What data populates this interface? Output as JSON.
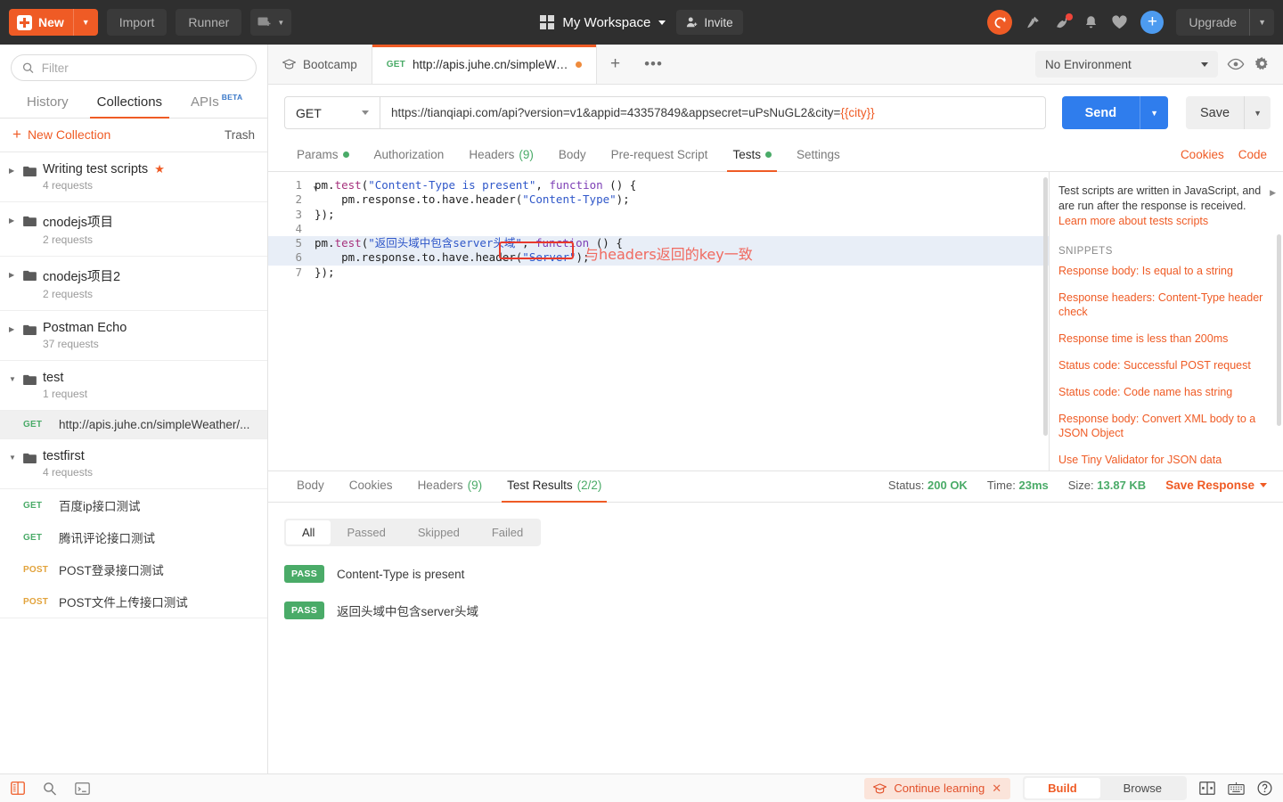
{
  "topbar": {
    "new_label": "New",
    "import_label": "Import",
    "runner_label": "Runner",
    "workspace_label": "My Workspace",
    "invite_label": "Invite",
    "upgrade_label": "Upgrade",
    "accent": "#ef5b25"
  },
  "sidebar": {
    "filter_placeholder": "Filter",
    "tabs": [
      {
        "label": "History",
        "active": false
      },
      {
        "label": "Collections",
        "active": true
      },
      {
        "label": "APIs",
        "sup": "BETA",
        "active": false
      }
    ],
    "new_collection_label": "New Collection",
    "trash_label": "Trash",
    "collections": [
      {
        "name": "Writing test scripts",
        "sub": "4 requests",
        "starred": true,
        "expanded": false
      },
      {
        "name": "cnodejs项目",
        "sub": "2 requests",
        "starred": false,
        "expanded": false
      },
      {
        "name": "cnodejs项目2",
        "sub": "2 requests",
        "starred": false,
        "expanded": false
      },
      {
        "name": "Postman Echo",
        "sub": "37 requests",
        "starred": false,
        "expanded": false
      },
      {
        "name": "test",
        "sub": "1 request",
        "starred": false,
        "expanded": true
      },
      {
        "name": "testfirst",
        "sub": "4 requests",
        "starred": false,
        "expanded": true
      }
    ],
    "test_requests": [
      {
        "method": "GET",
        "name": "http://apis.juhe.cn/simpleWeather/...",
        "selected": true
      }
    ],
    "testfirst_requests": [
      {
        "method": "GET",
        "name": "百度ip接口测试",
        "selected": false
      },
      {
        "method": "GET",
        "name": "腾讯评论接口测试",
        "selected": false
      },
      {
        "method": "POST",
        "name": "POST登录接口测试",
        "selected": false
      },
      {
        "method": "POST",
        "name": "POST文件上传接口测试",
        "selected": false
      }
    ]
  },
  "request_tabs": [
    {
      "label": "Bootcamp",
      "active": false,
      "icon": "graduation-cap"
    },
    {
      "method": "GET",
      "label": "http://apis.juhe.cn/simpleWeat...",
      "active": true,
      "unsaved": true
    }
  ],
  "environment": {
    "selected": "No Environment"
  },
  "request": {
    "method": "GET",
    "url_text": "https://tianqiapi.com/api?version=v1&appid=43357849&appsecret=uPsNuGL2&city=",
    "url_variable": "{{city}}",
    "send_label": "Send",
    "save_label": "Save",
    "tabs": [
      {
        "label": "Params",
        "dot": true,
        "active": false
      },
      {
        "label": "Authorization",
        "dot": false,
        "active": false
      },
      {
        "label": "Headers",
        "count": "(9)",
        "active": false
      },
      {
        "label": "Body",
        "dot": false,
        "active": false
      },
      {
        "label": "Pre-request Script",
        "dot": false,
        "active": false
      },
      {
        "label": "Tests",
        "dot": true,
        "active": true
      },
      {
        "label": "Settings",
        "dot": false,
        "active": false
      }
    ],
    "cookies_label": "Cookies",
    "code_label": "Code"
  },
  "editor": {
    "lines": [
      {
        "n": "1",
        "fold": true,
        "highlight": false,
        "tokens": [
          {
            "t": "pm.",
            "c": "pm"
          },
          {
            "t": "test",
            "c": "fn"
          },
          {
            "t": "(",
            "c": "pl"
          },
          {
            "t": "\"Content-Type is present\"",
            "c": "str"
          },
          {
            "t": ", ",
            "c": "pl"
          },
          {
            "t": "function",
            "c": "kw"
          },
          {
            "t": " () {",
            "c": "pl"
          }
        ]
      },
      {
        "n": "2",
        "fold": false,
        "highlight": false,
        "tokens": [
          {
            "t": "    pm.response.to.have.header(",
            "c": "pm"
          },
          {
            "t": "\"Content-Type\"",
            "c": "str"
          },
          {
            "t": ");",
            "c": "pl"
          }
        ]
      },
      {
        "n": "3",
        "fold": false,
        "highlight": false,
        "tokens": [
          {
            "t": "});",
            "c": "pl"
          }
        ]
      },
      {
        "n": "4",
        "fold": false,
        "highlight": false,
        "tokens": [
          {
            "t": "",
            "c": "pl"
          }
        ]
      },
      {
        "n": "5",
        "fold": true,
        "highlight": true,
        "tokens": [
          {
            "t": "pm.",
            "c": "pm"
          },
          {
            "t": "test",
            "c": "fn"
          },
          {
            "t": "(",
            "c": "pl"
          },
          {
            "t": "\"返回头域中包含server头域\"",
            "c": "str"
          },
          {
            "t": ", ",
            "c": "pl"
          },
          {
            "t": "function",
            "c": "kw"
          },
          {
            "t": " () {",
            "c": "pl"
          }
        ]
      },
      {
        "n": "6",
        "fold": false,
        "highlight": true,
        "tokens": [
          {
            "t": "    pm.response.to.have.header(",
            "c": "pm"
          },
          {
            "t": "\"Server\"",
            "c": "str"
          },
          {
            "t": ");",
            "c": "pl"
          }
        ]
      },
      {
        "n": "7",
        "fold": false,
        "highlight": false,
        "tokens": [
          {
            "t": "});",
            "c": "pl"
          }
        ]
      }
    ],
    "annotation_text": "与headers返回的key一致",
    "annotation_color": "#e8392c"
  },
  "snippets": {
    "description": "Test scripts are written in JavaScript, and are run after the response is received.",
    "learn_more": "Learn more about tests scripts",
    "title": "SNIPPETS",
    "items": [
      "Response body: Is equal to a string",
      "Response headers: Content-Type header check",
      "Response time is less than 200ms",
      "Status code: Successful POST request",
      "Status code: Code name has string",
      "Response body: Convert XML body to a JSON Object",
      "Use Tiny Validator for JSON data"
    ]
  },
  "response": {
    "tabs": [
      {
        "label": "Body",
        "active": false
      },
      {
        "label": "Cookies",
        "active": false
      },
      {
        "label": "Headers",
        "count": "(9)",
        "active": false
      },
      {
        "label": "Test Results",
        "count": "(2/2)",
        "active": true
      }
    ],
    "status_label": "Status:",
    "status_value": "200 OK",
    "time_label": "Time:",
    "time_value": "23ms",
    "size_label": "Size:",
    "size_value": "13.87 KB",
    "save_response_label": "Save Response",
    "filters": [
      {
        "label": "All",
        "active": true
      },
      {
        "label": "Passed",
        "active": false
      },
      {
        "label": "Skipped",
        "active": false
      },
      {
        "label": "Failed",
        "active": false
      }
    ],
    "results": [
      {
        "badge": "PASS",
        "name": "Content-Type is present"
      },
      {
        "badge": "PASS",
        "name": "返回头域中包含server头域"
      }
    ]
  },
  "statusbar": {
    "continue_learning": "Continue learning",
    "build_label": "Build",
    "browse_label": "Browse"
  }
}
